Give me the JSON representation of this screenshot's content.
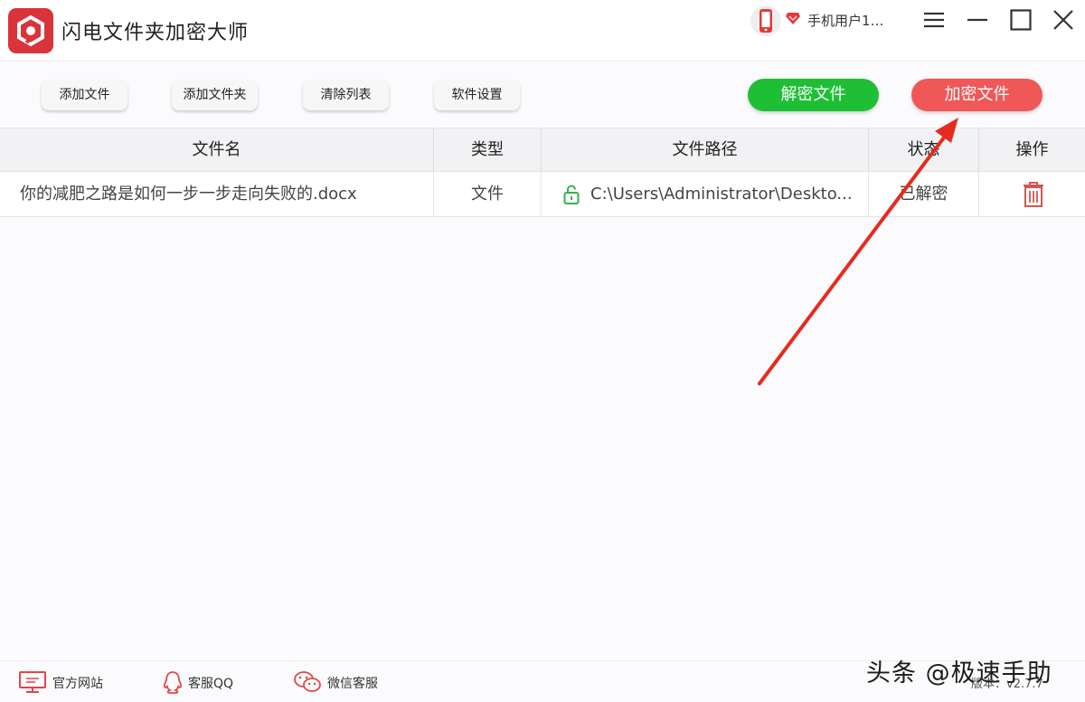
{
  "app": {
    "title": "闪电文件夹加密大师",
    "user_name": "手机用户1…"
  },
  "toolbar": {
    "add_file": "添加文件",
    "add_folder": "添加文件夹",
    "clear_list": "清除列表",
    "settings": "软件设置",
    "decrypt": "解密文件",
    "encrypt": "加密文件"
  },
  "colors": {
    "decrypt_green": "#1fbf35",
    "encrypt_red": "#f05858",
    "logo_red": "#d9333b",
    "unlock_green": "#36b24a",
    "trash_red": "#d2574e",
    "arrow_red": "#e52b20"
  },
  "table": {
    "columns": [
      "文件名",
      "类型",
      "文件路径",
      "状态",
      "操作"
    ],
    "rows": [
      {
        "name": "你的减肥之路是如何一步一步走向失败的.docx",
        "type": "文件",
        "path": "C:\\Users\\Administrator\\Deskto...",
        "status": "已解密",
        "icons": [
          "unlock-icon",
          "trash-icon"
        ]
      }
    ]
  },
  "footer": {
    "website": "官方网站",
    "qq": "客服QQ",
    "wechat": "微信客服",
    "version": "版本：v2.7.7"
  },
  "watermark": "头条 @极速手助"
}
